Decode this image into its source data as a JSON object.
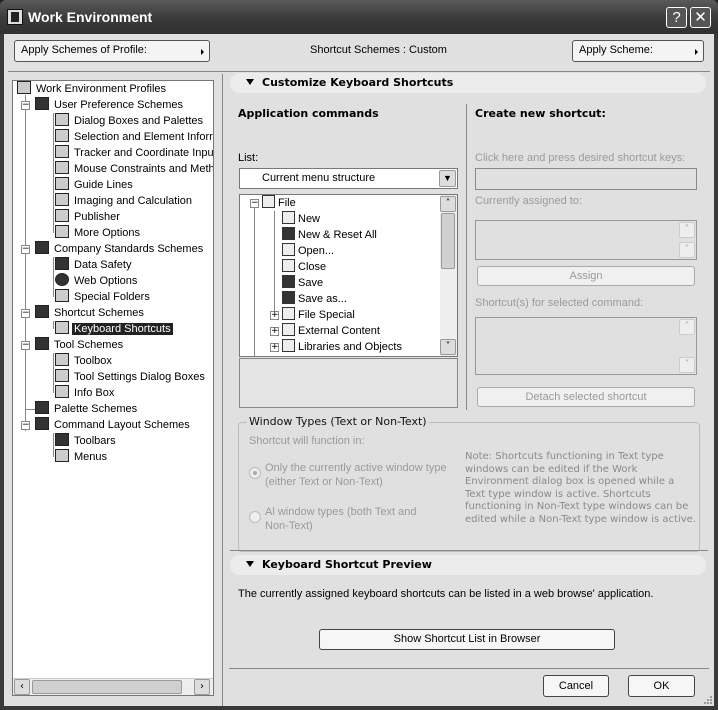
{
  "window": {
    "title": "Work Environment",
    "help_label": "?",
    "close_label": "✕"
  },
  "toolbar": {
    "apply_profile_label": "Apply Schemes of Profile:",
    "scheme_status": "Shortcut Schemes : Custom",
    "apply_scheme_label": "Apply Scheme:"
  },
  "sidebar": {
    "root": {
      "label": "Work Environment Profiles",
      "icon": "profiles-icon"
    },
    "groups": [
      {
        "label": "User Preference Schemes",
        "icon": "user-preference-icon",
        "expanded": true,
        "items": [
          {
            "label": "Dialog Boxes and Palettes",
            "icon": "dialog-boxes-icon"
          },
          {
            "label": "Selection and Element Inforr",
            "icon": "selection-icon"
          },
          {
            "label": "Tracker and Coordinate Inpu",
            "icon": "tracker-icon"
          },
          {
            "label": "Mouse Constraints and Meth",
            "icon": "mouse-icon"
          },
          {
            "label": "Guide Lines",
            "icon": "guide-lines-icon"
          },
          {
            "label": "Imaging and Calculation",
            "icon": "imaging-icon"
          },
          {
            "label": "Publisher",
            "icon": "publisher-icon"
          },
          {
            "label": "More Options",
            "icon": "more-options-icon"
          }
        ]
      },
      {
        "label": "Company Standards Schemes",
        "icon": "company-standards-icon",
        "expanded": true,
        "items": [
          {
            "label": "Data Safety",
            "icon": "data-safety-icon"
          },
          {
            "label": "Web Options",
            "icon": "web-options-icon"
          },
          {
            "label": "Special Folders",
            "icon": "special-folders-icon"
          }
        ]
      },
      {
        "label": "Shortcut Schemes",
        "icon": "shortcut-schemes-icon",
        "expanded": true,
        "items": [
          {
            "label": "Keyboard Shortcuts",
            "icon": "keyboard-shortcuts-icon",
            "selected": true
          }
        ]
      },
      {
        "label": "Tool Schemes",
        "icon": "tool-schemes-icon",
        "expanded": true,
        "items": [
          {
            "label": "Toolbox",
            "icon": "toolbox-icon"
          },
          {
            "label": "Tool Settings Dialog Boxes",
            "icon": "tool-settings-icon"
          },
          {
            "label": "Info Box",
            "icon": "info-box-icon"
          }
        ]
      },
      {
        "label": "Palette Schemes",
        "icon": "palette-schemes-icon",
        "expanded": false,
        "items": []
      },
      {
        "label": "Command Layout Schemes",
        "icon": "command-layout-icon",
        "expanded": true,
        "items": [
          {
            "label": "Toolbars",
            "icon": "toolbars-icon"
          },
          {
            "label": "Menus",
            "icon": "menus-icon"
          }
        ]
      }
    ]
  },
  "customize": {
    "header": "Customize Keyboard Shortcuts",
    "app_commands_title": "Application commands",
    "list_label": "List:",
    "list_selected": "Current menu structure",
    "commands": [
      {
        "label": "File",
        "icon": "folder-icon",
        "level": 0,
        "expander": "−"
      },
      {
        "label": "New",
        "icon": "new-document-icon",
        "level": 1
      },
      {
        "label": "New & Reset All",
        "icon": "new-reset-icon",
        "level": 1
      },
      {
        "label": "Open...",
        "icon": "open-folder-icon",
        "level": 1
      },
      {
        "label": "Close",
        "icon": "close-document-icon",
        "level": 1
      },
      {
        "label": "Save",
        "icon": "save-icon",
        "level": 1
      },
      {
        "label": "Save as...",
        "icon": "save-as-icon",
        "level": 1
      },
      {
        "label": "File Special",
        "icon": "folder-icon",
        "level": 1,
        "expander": "+"
      },
      {
        "label": "External Content",
        "icon": "folder-icon",
        "level": 1,
        "expander": "+"
      },
      {
        "label": "Libraries and Objects",
        "icon": "folder-icon",
        "level": 1,
        "expander": "+"
      }
    ],
    "create_title": "Create new shortcut:",
    "press_keys_label": "Click here and press desired shortcut keys:",
    "press_keys_value": "",
    "assigned_label": "Currently assigned to:",
    "assign_button": "Assign",
    "shortcuts_label": "Shortcut(s) for selected command:",
    "detach_button": "Detach selected shortcut",
    "window_types": {
      "legend": "Window Types (Text or Non-Text)",
      "function_label": "Shortcut will function in:",
      "option1": "Only the currently active window type (either Text or Non-Text)",
      "option1_line1": "Only the currently active window type",
      "option1_line2": "(either Text or Non-Text)",
      "option2_line1": "Al window types (both Text and",
      "option2_line2": "Non-Text)",
      "selected": "option1",
      "note": "Note: Shortcuts functioning in Text type windows can be edited if the Work Environment dialog box is opened while a Text type window is active. Shortcuts functioning in Non-Text type windows can be edited while a Non-Text type window is active."
    }
  },
  "preview": {
    "header": "Keyboard Shortcut Preview",
    "description": "The currently assigned keyboard shortcuts can be listed in a web browse' application.",
    "show_button": "Show Shortcut List in Browser"
  },
  "footer": {
    "cancel_label": "Cancel",
    "ok_label": "OK"
  }
}
